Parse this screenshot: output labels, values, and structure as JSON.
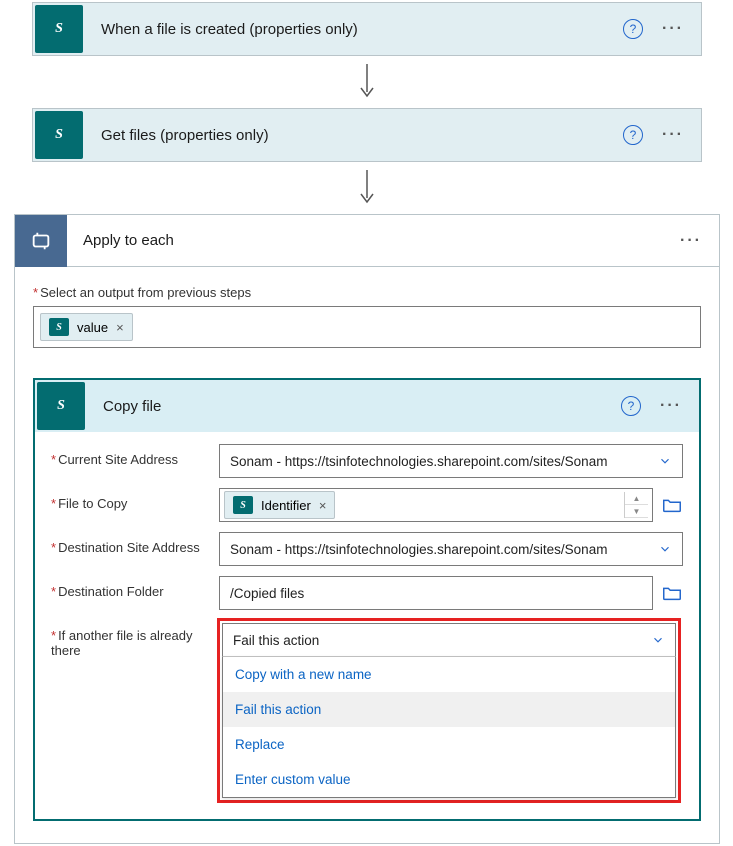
{
  "step1": {
    "title": "When a file is created (properties only)"
  },
  "step2": {
    "title": "Get files (properties only)"
  },
  "apply": {
    "title": "Apply to each",
    "output_label": "Select an output from previous steps",
    "token": "value"
  },
  "copy": {
    "title": "Copy file",
    "fields": {
      "site_label": "Current Site Address",
      "site_value": "Sonam - https://tsinfotechnologies.sharepoint.com/sites/Sonam",
      "file_label": "File to Copy",
      "file_token": "Identifier",
      "dest_site_label": "Destination Site Address",
      "dest_site_value": "Sonam - https://tsinfotechnologies.sharepoint.com/sites/Sonam",
      "dest_folder_label": "Destination Folder",
      "dest_folder_value": "/Copied files",
      "conflict_label": "If another file is already there",
      "conflict_value": "Fail this action"
    },
    "dropdown_options": [
      "Copy with a new name",
      "Fail this action",
      "Replace",
      "Enter custom value"
    ]
  }
}
